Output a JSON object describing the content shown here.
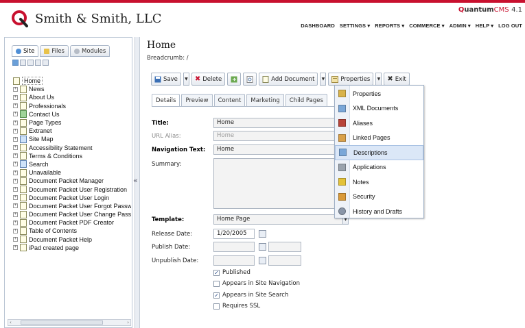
{
  "header": {
    "company": "Smith & Smith, LLC",
    "brand_q": "Q",
    "brand_rest": "uantum",
    "brand_cms": "CMS",
    "brand_version": "4.1",
    "nav": [
      "DASHBOARD",
      "SETTINGS ▾",
      "REPORTS ▾",
      "COMMERCE ▾",
      "ADMIN ▾",
      "HELP ▾",
      "LOG OUT"
    ]
  },
  "sidebar": {
    "tabs": [
      "Site",
      "Files",
      "Modules"
    ],
    "tree_root": "Home",
    "tree_items": [
      "News",
      "About Us",
      "Professionals",
      "Contact Us",
      "Page Types",
      "Extranet",
      "Site Map",
      "Accessibility Statement",
      "Terms & Conditions",
      "Search",
      "Unavailable",
      "Document Packet Manager",
      "Document Packet User Registration",
      "Document Packet User Login",
      "Document Packet User Forgot Password",
      "Document Packet User Change Password",
      "Document Packet PDF Creator",
      "Table of Contents",
      "Document Packet Help",
      "iPad created page"
    ],
    "collapse_glyph": "«"
  },
  "main": {
    "title": "Home",
    "breadcrumb": "Breadcrumb: /",
    "toolbar": {
      "save": "Save",
      "delete": "Delete",
      "add_document": "Add Document",
      "properties": "Properties",
      "exit": "Exit"
    },
    "tabs": [
      "Details",
      "Preview",
      "Content",
      "Marketing",
      "Child Pages"
    ],
    "form": {
      "title_label": "Title:",
      "title_value": "Home",
      "url_alias_label": "URL Alias:",
      "url_alias_value": "Home",
      "nav_text_label": "Navigation Text:",
      "nav_text_value": "Home",
      "summary_label": "Summary:",
      "template_label": "Template:",
      "template_value": "Home Page",
      "release_label": "Release Date:",
      "release_value": "1/20/2005",
      "publish_label": "Publish Date:",
      "unpublish_label": "Unpublish Date:"
    },
    "checkboxes": [
      {
        "label": "Published",
        "checked": true
      },
      {
        "label": "Appears in Site Navigation",
        "checked": false
      },
      {
        "label": "Appears in Site Search",
        "checked": true
      },
      {
        "label": "Requires SSL",
        "checked": false
      }
    ]
  },
  "dropdown": {
    "items": [
      {
        "label": "Properties",
        "icon": "properties-icon"
      },
      {
        "label": "XML Documents",
        "icon": "xml-document-icon"
      },
      {
        "label": "Aliases",
        "icon": "aliases-icon"
      },
      {
        "label": "Linked Pages",
        "icon": "linked-pages-icon"
      },
      {
        "label": "Descriptions",
        "icon": "descriptions-icon"
      },
      {
        "label": "Applications",
        "icon": "applications-icon"
      },
      {
        "label": "Notes",
        "icon": "notes-icon"
      },
      {
        "label": "Security",
        "icon": "security-icon"
      },
      {
        "label": "History and Drafts",
        "icon": "history-icon"
      }
    ],
    "highlighted_index": 4
  },
  "colors": {
    "brand_red": "#c8102e",
    "highlight": "#dbe7f7"
  }
}
